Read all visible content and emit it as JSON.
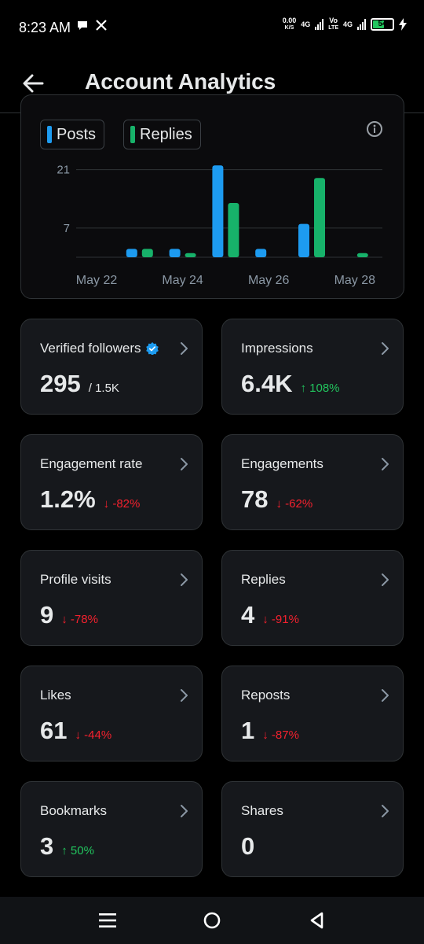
{
  "status_bar": {
    "time": "8:23 AM",
    "speed_value": "0.00",
    "speed_unit": "K/S",
    "net1": "4G",
    "volte_top": "Vo",
    "volte_bottom": "LTE",
    "net2": "4G",
    "battery": "54",
    "icons": [
      "chat-bubble-icon",
      "x-logo-icon",
      "signal-icon",
      "battery-icon",
      "charging-icon"
    ]
  },
  "header": {
    "title": "Account Analytics"
  },
  "legend": {
    "posts": "Posts",
    "replies": "Replies"
  },
  "colors": {
    "posts": "#1d9bf0",
    "replies": "#17b26a",
    "up": "#22c55e",
    "down": "#f4212e",
    "verified": "#1d9bf0"
  },
  "chart_data": {
    "type": "bar",
    "x_tick_labels": [
      "May 22",
      "May 24",
      "May 26",
      "May 28"
    ],
    "y_tick_labels": [
      "21",
      "7"
    ],
    "y_ticks": [
      21,
      7
    ],
    "ylim": [
      0,
      23
    ],
    "categories": [
      "May 22",
      "May 23",
      "May 24",
      "May 25",
      "May 26",
      "May 27",
      "May 28"
    ],
    "series": [
      {
        "name": "Posts",
        "values": [
          0,
          2,
          2,
          22,
          2,
          8,
          0
        ]
      },
      {
        "name": "Replies",
        "values": [
          0,
          2,
          1,
          13,
          0,
          19,
          1
        ]
      }
    ],
    "grid": true
  },
  "metrics": [
    {
      "label": "Verified followers",
      "verified": true,
      "value": "295",
      "sub": "/ 1.5K",
      "delta": "",
      "direction": ""
    },
    {
      "label": "Impressions",
      "verified": false,
      "value": "6.4K",
      "sub": "",
      "delta": "108%",
      "direction": "up"
    },
    {
      "label": "Engagement rate",
      "verified": false,
      "value": "1.2%",
      "sub": "",
      "delta": "-82%",
      "direction": "down"
    },
    {
      "label": "Engagements",
      "verified": false,
      "value": "78",
      "sub": "",
      "delta": "-62%",
      "direction": "down"
    },
    {
      "label": "Profile visits",
      "verified": false,
      "value": "9",
      "sub": "",
      "delta": "-78%",
      "direction": "down"
    },
    {
      "label": "Replies",
      "verified": false,
      "value": "4",
      "sub": "",
      "delta": "-91%",
      "direction": "down"
    },
    {
      "label": "Likes",
      "verified": false,
      "value": "61",
      "sub": "",
      "delta": "-44%",
      "direction": "down"
    },
    {
      "label": "Reposts",
      "verified": false,
      "value": "1",
      "sub": "",
      "delta": "-87%",
      "direction": "down"
    },
    {
      "label": "Bookmarks",
      "verified": false,
      "value": "3",
      "sub": "",
      "delta": "50%",
      "direction": "up"
    },
    {
      "label": "Shares",
      "verified": false,
      "value": "0",
      "sub": "",
      "delta": "",
      "direction": ""
    }
  ],
  "nav": [
    "recent-apps-icon",
    "home-icon",
    "back-icon"
  ]
}
